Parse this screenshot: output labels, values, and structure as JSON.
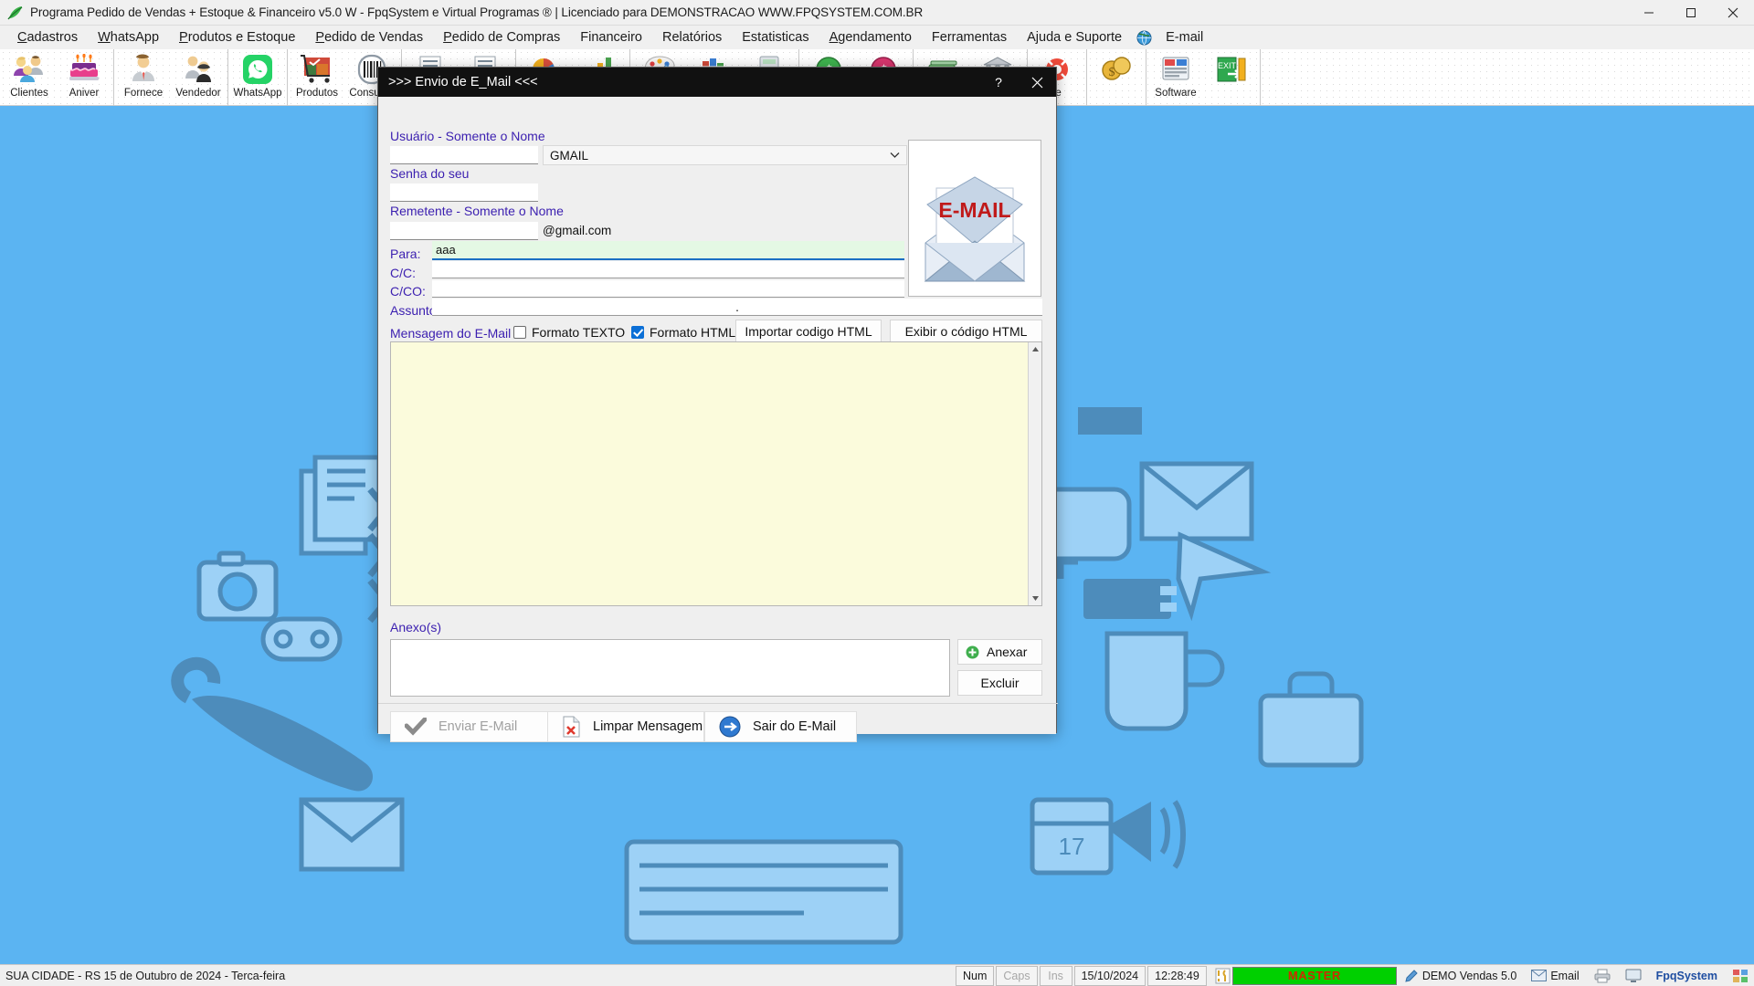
{
  "window": {
    "title": "Programa Pedido de Vendas + Estoque & Financeiro v5.0 W - FpqSystem e Virtual Programas ® | Licenciado para  DEMONSTRACAO WWW.FPQSYSTEM.COM.BR",
    "app_icon": "green-leaf-icon",
    "minimize": "—",
    "maximize": "❐",
    "close": "✕"
  },
  "menu": {
    "items": [
      {
        "label": "Cadastros",
        "accel": "C"
      },
      {
        "label": "WhatsApp",
        "accel": "W"
      },
      {
        "label": "Produtos e Estoque",
        "accel": "P"
      },
      {
        "label": "Pedido de Vendas",
        "accel": "P"
      },
      {
        "label": "Pedido de Compras",
        "accel": "P"
      },
      {
        "label": "Financeiro",
        "accel": ""
      },
      {
        "label": "Relatórios",
        "accel": ""
      },
      {
        "label": "Estatisticas",
        "accel": ""
      },
      {
        "label": "Agendamento",
        "accel": "A"
      },
      {
        "label": "Ferramentas",
        "accel": ""
      },
      {
        "label": "Ajuda e Suporte",
        "accel": ""
      },
      {
        "label": "E-mail",
        "accel": ""
      }
    ],
    "globe_icon": "globe-icon"
  },
  "toolbar": {
    "groups": [
      {
        "buttons": [
          {
            "label": "Clientes",
            "icon": "clients-icon"
          },
          {
            "label": "Aniver",
            "icon": "birthday-cake-icon"
          }
        ]
      },
      {
        "buttons": [
          {
            "label": "Fornece",
            "icon": "supplier-person-icon"
          },
          {
            "label": "Vendedor",
            "icon": "salesperson-icon"
          }
        ]
      },
      {
        "buttons": [
          {
            "label": "WhatsApp",
            "icon": "whatsapp-icon"
          }
        ]
      },
      {
        "buttons": [
          {
            "label": "Produtos",
            "icon": "shopping-cart-icon"
          },
          {
            "label": "Consultar",
            "icon": "barcode-icon"
          }
        ]
      },
      {
        "buttons": [
          {
            "label": "",
            "icon": "sales-order-icon"
          },
          {
            "label": "",
            "icon": "purchase-order-icon"
          }
        ]
      },
      {
        "buttons": [
          {
            "label": "",
            "icon": "pie-chart-icon"
          },
          {
            "label": "",
            "icon": "bar-chart-icon"
          }
        ]
      },
      {
        "buttons": [
          {
            "label": "",
            "icon": "paint-palette-icon"
          },
          {
            "label": "",
            "icon": "books-icon"
          },
          {
            "label": "",
            "icon": "calculator-icon"
          }
        ]
      },
      {
        "buttons": [
          {
            "label": "",
            "icon": "green-money-icon"
          },
          {
            "label": "",
            "icon": "red-money-icon"
          }
        ]
      },
      {
        "buttons": [
          {
            "label": "",
            "icon": "money-stack-icon"
          },
          {
            "label": "",
            "icon": "bank-icon"
          }
        ]
      },
      {
        "buttons": [
          {
            "label": "te",
            "icon": "support-icon"
          }
        ]
      },
      {
        "buttons": [
          {
            "label": "",
            "icon": "coins-icon"
          }
        ]
      },
      {
        "buttons": [
          {
            "label": "Software",
            "icon": "software-icon"
          },
          {
            "label": "",
            "icon": "exit-icon"
          }
        ]
      }
    ]
  },
  "dialog": {
    "title": ">>> Envio de E_Mail <<<",
    "help_button": "?",
    "close_button": "✕",
    "fields": {
      "user_label": "Usuário - Somente o Nome",
      "user_value": "",
      "provider_value": "GMAIL",
      "provider_options": [
        "GMAIL"
      ],
      "password_label": "Senha do seu",
      "password_value": "",
      "sender_label": "Remetente - Somente o Nome",
      "sender_value": "",
      "sender_domain": "@gmail.com",
      "to_label": "Para:",
      "to_value": "aaa",
      "cc_label": "C/C:",
      "cc_value": "",
      "bcc_label": "C/CO:",
      "bcc_value": "",
      "subject_label": "Assunto",
      "subject_value": "."
    },
    "email_image_alt": "E-MAIL",
    "email_image_text": "E-MAIL",
    "message": {
      "label": "Mensagem do E-Mail",
      "format_text_label": "Formato TEXTO",
      "format_text_checked": false,
      "format_html_label": "Formato HTML",
      "format_html_checked": true,
      "import_html_button": "Importar codigo HTML",
      "show_html_button": "Exibir o código HTML",
      "body_value": ""
    },
    "attachments": {
      "label": "Anexo(s)",
      "list": [],
      "attach_button": "Anexar",
      "delete_button": "Excluir",
      "attach_icon": "add-green-icon"
    },
    "actions": [
      {
        "label": "Enviar E-Mail",
        "icon": "check-mark-icon",
        "disabled": true
      },
      {
        "label": "Limpar Mensagem",
        "icon": "clear-document-icon",
        "disabled": false
      },
      {
        "label": "Sair do E-Mail",
        "icon": "exit-arrow-icon",
        "disabled": false
      }
    ]
  },
  "statusbar": {
    "location": "SUA CIDADE - RS 15 de Outubro de 2024 - Terca-feira",
    "num": "Num",
    "caps": "Caps",
    "ins": "Ins",
    "date": "15/10/2024",
    "time": "12:28:49",
    "master_badge": "MASTER",
    "master_icon": "tools-icon",
    "demo": "DEMO Vendas 5.0",
    "demo_icon": "pencil-icon",
    "email": "Email",
    "email_icon": "envelope-icon",
    "fpq": "FpqSystem",
    "printer_icon": "printer-icon",
    "monitor_icon": "monitor-icon",
    "grid_icon": "grid-icon"
  },
  "colors": {
    "desktop": "#5bb4f2",
    "dialog_title_bg": "#111111",
    "label_purple": "#3b1fb0",
    "message_bg": "#fbfbdc",
    "focus_field_bg": "#e4f8e4",
    "focus_underline": "#1a6fc4",
    "checkbox_checked": "#0b6fd6",
    "status_green": "#00d000",
    "status_master_text": "#cf2b00"
  }
}
